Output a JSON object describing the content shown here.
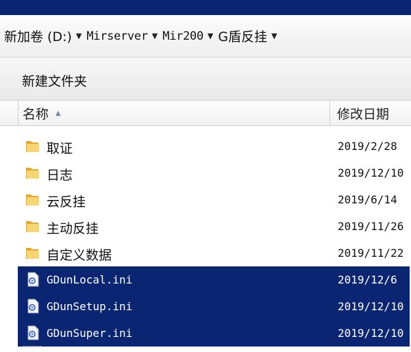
{
  "breadcrumb": [
    {
      "label": "新加卷 (D:)",
      "mono": false
    },
    {
      "label": "Mirserver",
      "mono": true
    },
    {
      "label": "Mir200",
      "mono": true
    },
    {
      "label": "G盾反挂",
      "mono": false
    }
  ],
  "toolbar": {
    "new_folder_label": "新建文件夹"
  },
  "columns": {
    "name": "名称",
    "date_modified": "修改日期"
  },
  "files": [
    {
      "name": "取证",
      "date": "2019/2/28",
      "type": "folder",
      "selected": false
    },
    {
      "name": "日志",
      "date": "2019/12/10",
      "type": "folder",
      "selected": false
    },
    {
      "name": "云反挂",
      "date": "2019/6/14",
      "type": "folder",
      "selected": false
    },
    {
      "name": "主动反挂",
      "date": "2019/11/26",
      "type": "folder",
      "selected": false
    },
    {
      "name": "自定义数据",
      "date": "2019/11/22",
      "type": "folder",
      "selected": false
    },
    {
      "name": "GDunLocal.ini",
      "date": "2019/12/6",
      "type": "ini",
      "selected": true
    },
    {
      "name": "GDunSetup.ini",
      "date": "2019/12/10",
      "type": "ini",
      "selected": true
    },
    {
      "name": "GDunSuper.ini",
      "date": "2019/12/10",
      "type": "ini",
      "selected": true
    }
  ],
  "colors": {
    "selection": "#0a2673",
    "folder": "#f2c34e"
  }
}
